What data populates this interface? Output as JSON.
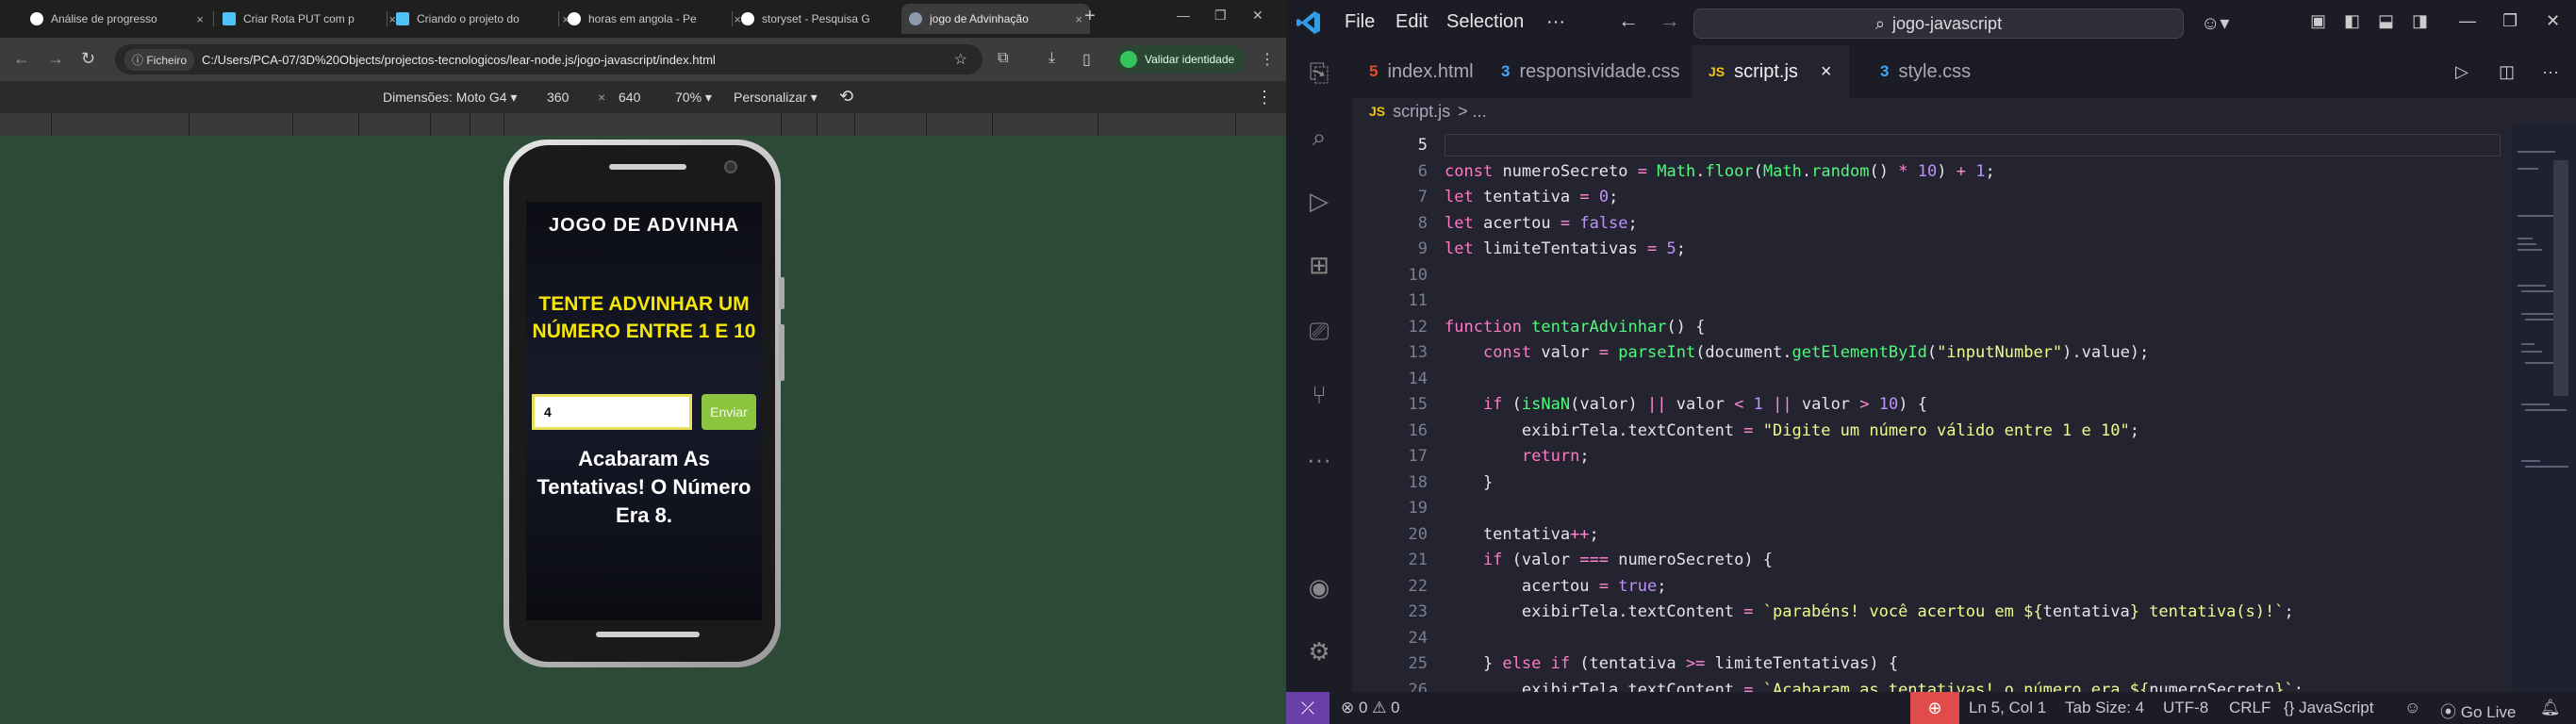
{
  "browser": {
    "tabs": [
      {
        "title": "Análise de progresso",
        "favicon_color": "#ffffff"
      },
      {
        "title": "Criar Rota PUT com p",
        "favicon_color": "#4fc3f7"
      },
      {
        "title": "Criando o projeto do",
        "favicon_color": "#4fc3f7"
      },
      {
        "title": "horas em angola - Pe",
        "favicon_color": "#ffffff"
      },
      {
        "title": "storyset - Pesquisa G",
        "favicon_color": "#ffffff"
      },
      {
        "title": "jogo de Advinhação",
        "favicon_color": "#8a9aaa"
      }
    ],
    "close_glyph": "×",
    "new_tab_glyph": "+",
    "file_chip": "Ficheiro",
    "url": "C:/Users/PCA-07/3D%20Objects/projectos-tecnologicos/lear-node.js/jogo-javascript/index.html",
    "profile_label": "Validar identidade",
    "devtools": {
      "dimensions_label": "Dimensões: Moto G4 ▾",
      "width": "360",
      "times": "×",
      "height": "640",
      "zoom": "70% ▾",
      "throttle": "Personalizar ▾"
    }
  },
  "game": {
    "title": "JOGO DE ADVINHA",
    "prompt": "TENTE ADVINHAR UM NÚMERO ENTRE 1 E 10",
    "input_value": "4",
    "send_label": "Enviar",
    "result": "Acabaram As Tentativas! O Número Era 8."
  },
  "vscode": {
    "menu": [
      "File",
      "Edit",
      "Selection",
      "···"
    ],
    "search": "jogo-javascript",
    "tabs": [
      {
        "label": "index.html",
        "icon": "html-icon",
        "badge": "5",
        "color": "#e44d26"
      },
      {
        "label": "responsividade.css",
        "icon": "css-icon",
        "badge": "3",
        "color": "#42a5f5"
      },
      {
        "label": "script.js",
        "icon": "js-icon",
        "badge": "JS",
        "color": "#f1c40f"
      },
      {
        "label": "style.css",
        "icon": "css-icon",
        "badge": "3",
        "color": "#42a5f5"
      }
    ],
    "active_tab_close": "×",
    "breadcrumb": {
      "file": "script.js",
      "rest": "> ..."
    },
    "line_numbers": [
      "5",
      "6",
      "7",
      "8",
      "9",
      "10",
      "11",
      "12",
      "13",
      "14",
      "15",
      "16",
      "17",
      "18",
      "19",
      "20",
      "21",
      "22",
      "23",
      "24",
      "25",
      "26"
    ],
    "status": {
      "remote": "⤫",
      "problems": "⊗ 0 ⚠ 0",
      "position": "Ln 5, Col 1",
      "tab_size": "Tab Size: 4",
      "encoding": "UTF-8",
      "eol": "CRLF",
      "language": "{} JavaScript",
      "go_live": "Go Live"
    }
  }
}
